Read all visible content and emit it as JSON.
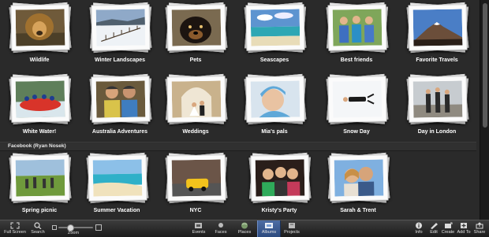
{
  "albums_row1": [
    {
      "label": "Wildlife",
      "icon": "lion"
    },
    {
      "label": "Winter Landscapes",
      "icon": "snow-field"
    },
    {
      "label": "Pets",
      "icon": "dog"
    },
    {
      "label": "Seascapes",
      "icon": "sea"
    },
    {
      "label": "Best friends",
      "icon": "friends"
    },
    {
      "label": "Favorite Travels",
      "icon": "mountain"
    }
  ],
  "albums_row2": [
    {
      "label": "White Water!",
      "icon": "raft"
    },
    {
      "label": "Australia Adventures",
      "icon": "kids"
    },
    {
      "label": "Weddings",
      "icon": "wedding"
    },
    {
      "label": "Mia's pals",
      "icon": "girl"
    },
    {
      "label": "Snow Day",
      "icon": "snow-angel"
    },
    {
      "label": "Day in London",
      "icon": "london"
    }
  ],
  "section_header": "Facebook (Ryan Nosek)",
  "albums_row3": [
    {
      "label": "Spring picnic",
      "icon": "picnic"
    },
    {
      "label": "Summer Vacation",
      "icon": "beach"
    },
    {
      "label": "NYC",
      "icon": "taxi"
    },
    {
      "label": "Kristy's Party",
      "icon": "party"
    },
    {
      "label": "Sarah & Trent",
      "icon": "couple"
    }
  ],
  "toolbar": {
    "full_screen": "Full Screen",
    "search": "Search",
    "zoom": "Zoom",
    "events": "Events",
    "faces": "Faces",
    "places": "Places",
    "albums": "Albums",
    "projects": "Projects",
    "info": "Info",
    "edit": "Edit",
    "create": "Create",
    "add_to": "Add To",
    "share": "Share",
    "zoom_level": 0.35
  },
  "colors": {
    "background": "#2a2a2a",
    "active_tab": "#3d5f98"
  }
}
